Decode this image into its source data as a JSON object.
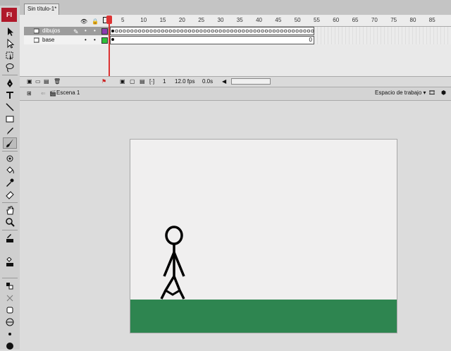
{
  "app": {
    "logo": "Fl"
  },
  "document": {
    "tab_title": "Sin título-1*"
  },
  "timeline": {
    "ruler_marks": [
      "5",
      "10",
      "15",
      "20",
      "25",
      "30",
      "35",
      "40",
      "45",
      "50",
      "55",
      "60",
      "65",
      "70",
      "75",
      "80",
      "85"
    ],
    "last_frame": "0",
    "layers": [
      {
        "name": "dibujos",
        "selected": true,
        "color": "#8e3bb0"
      },
      {
        "name": "base",
        "selected": false,
        "color": "#2fbf3a"
      }
    ],
    "current_frame": "1",
    "fps": "12.0 fps",
    "time": "0.0s"
  },
  "scene": {
    "name": "Escena 1",
    "workspace_label": "Espacio de trabajo ▾"
  },
  "stage": {
    "background": "#f0efef",
    "ground_color": "#2e8550"
  },
  "tools": [
    "selection-icon",
    "subselection-icon",
    "free-transform-icon",
    "lasso-icon",
    "pen-icon",
    "text-icon",
    "line-icon",
    "rectangle-icon",
    "pencil-icon",
    "brush-icon",
    "deco-icon",
    "paint-bucket-icon",
    "eyedropper-icon",
    "eraser-icon",
    "hand-icon",
    "zoom-icon",
    "stroke-color-icon",
    "fill-color-icon"
  ]
}
